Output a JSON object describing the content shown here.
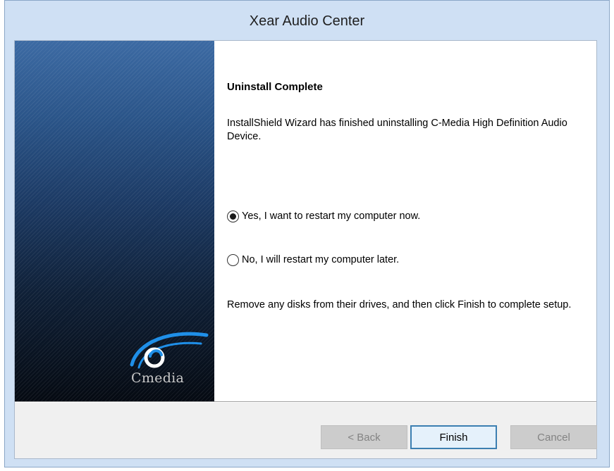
{
  "window": {
    "title": "Xear Audio Center"
  },
  "banner": {
    "logo_text": "Cmedia",
    "logo_icon": "cmedia-swirl-logo-icon"
  },
  "content": {
    "heading": "Uninstall Complete",
    "message": "InstallShield Wizard has finished uninstalling C-Media High Definition Audio Device.",
    "options": [
      {
        "label": "Yes, I want to restart my computer now.",
        "selected": true
      },
      {
        "label": "No, I will restart my computer later.",
        "selected": false
      }
    ],
    "footer_note": "Remove any disks from their drives, and then click Finish to complete setup."
  },
  "buttons": {
    "back_label": "< Back",
    "finish_label": "Finish",
    "cancel_label": "Cancel",
    "back_enabled": false,
    "cancel_enabled": false
  },
  "colors": {
    "titlebar": "#cfe0f4",
    "banner_top": "#3c6aa3",
    "banner_bottom": "#050a12",
    "logo_blue": "#1e90ff",
    "default_button_border": "#3c7fb1"
  }
}
